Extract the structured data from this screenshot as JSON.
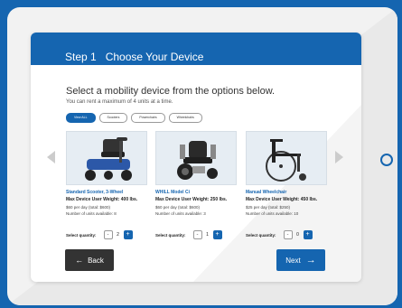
{
  "header": {
    "step": "Step 1",
    "title": "Choose Your Device"
  },
  "heading": "Select a mobility device from the options below.",
  "subheading": "You can rent a maximum of 4 units at a time.",
  "filters": [
    {
      "label": "View ALL",
      "active": true
    },
    {
      "label": "Scooters",
      "active": false
    },
    {
      "label": "Powerchairs",
      "active": false
    },
    {
      "label": "Wheelchairs",
      "active": false
    }
  ],
  "products": [
    {
      "name": "Standard Scooter, 3-Wheel",
      "weight_label": "Max Device User Weight:",
      "weight_value": "400 lbs.",
      "price": "$60 per day (total: $600)",
      "units": "Number of units available: 8",
      "quantity_label": "Select quantity:",
      "quantity": "2",
      "icon": "scooter-image"
    },
    {
      "name": "WHILL Model Ci",
      "weight_label": "Max Device User Weight:",
      "weight_value": "250 lbs.",
      "price": "$60 per day (total: $600)",
      "units": "Number of units available: 3",
      "quantity_label": "Select quantity:",
      "quantity": "1",
      "icon": "powerchair-image"
    },
    {
      "name": "Manual Wheelchair",
      "weight_label": "Max Device User Weight:",
      "weight_value": "450 lbs.",
      "price": "$25 per day (total: $250)",
      "units": "Number of units available: 10",
      "quantity_label": "Select quantity:",
      "quantity": "0",
      "icon": "wheelchair-image"
    }
  ],
  "buttons": {
    "back": "Back",
    "next": "Next"
  },
  "colors": {
    "brand_blue": "#1565b0",
    "back_button": "#333333",
    "card_bg": "#ffffff",
    "page_bg": "#f2f2f2"
  }
}
